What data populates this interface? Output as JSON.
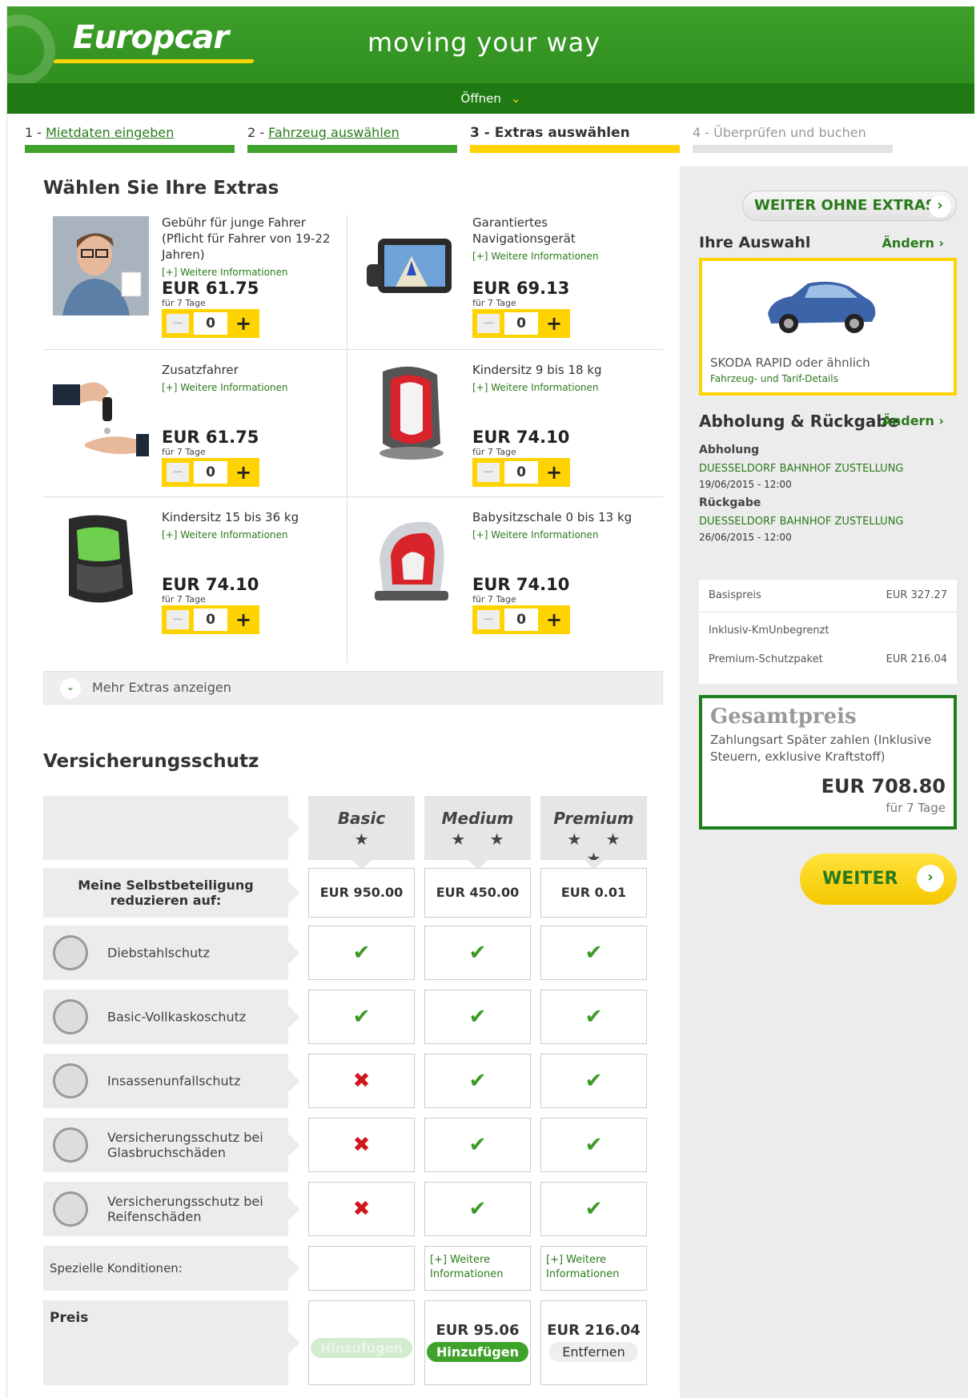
{
  "header": {
    "logo": "Europcar",
    "tagline": "moving your way",
    "open_label": "Öffnen"
  },
  "steps": [
    {
      "num": "1 - ",
      "label": "Mietdaten eingeben"
    },
    {
      "num": "2 - ",
      "label": "Fahrzeug auswählen"
    },
    {
      "num": "3 - ",
      "label": "Extras auswählen"
    },
    {
      "num": "4 - ",
      "label": "Überprüfen und buchen"
    }
  ],
  "extras": {
    "title": "Wählen Sie Ihre Extras",
    "more_info": "[+] Weitere Informationen",
    "items": [
      {
        "name": "Gebühr für junge Fahrer (Pflicht für Fahrer von 19-22 Jahren)",
        "price": "EUR 61.75",
        "days": "für 7 Tage",
        "qty": "0"
      },
      {
        "name": "Garantiertes Navigationsgerät",
        "price": "EUR 69.13",
        "days": "für 7 Tage",
        "qty": "0"
      },
      {
        "name": "Zusatzfahrer",
        "price": "EUR 61.75",
        "days": "für 7 Tage",
        "qty": "0"
      },
      {
        "name": "Kindersitz 9 bis 18 kg",
        "price": "EUR 74.10",
        "days": "für 7 Tage",
        "qty": "0"
      },
      {
        "name": "Kindersitz 15 bis 36 kg",
        "price": "EUR 74.10",
        "days": "für 7 Tage",
        "qty": "0"
      },
      {
        "name": "Babysitzschale 0 bis 13 kg",
        "price": "EUR 74.10",
        "days": "für 7 Tage",
        "qty": "0"
      }
    ],
    "show_more": "Mehr Extras anzeigen"
  },
  "insurance": {
    "title": "Versicherungsschutz",
    "plans": [
      {
        "name": "Basic",
        "stars": "★",
        "deductible": "EUR 950.00",
        "price": "",
        "action": "Hinzufügen"
      },
      {
        "name": "Medium",
        "stars": "★ ★",
        "deductible": "EUR 450.00",
        "price": "EUR 95.06",
        "action": "Hinzufügen"
      },
      {
        "name": "Premium",
        "stars": "★ ★ ★",
        "deductible": "EUR 0.01",
        "price": "EUR 216.04",
        "action": "Entfernen"
      }
    ],
    "deductible_label": "Meine Selbstbeteiligung reduzieren auf:",
    "features": [
      {
        "label": "Diebstahlschutz",
        "vals": [
          "✔",
          "✔",
          "✔"
        ]
      },
      {
        "label": "Basic-Vollkaskoschutz",
        "vals": [
          "✔",
          "✔",
          "✔"
        ]
      },
      {
        "label": "Insassenunfallschutz",
        "vals": [
          "✖",
          "✔",
          "✔"
        ]
      },
      {
        "label": "Versicherungsschutz bei Glasbruchschäden",
        "vals": [
          "✖",
          "✔",
          "✔"
        ]
      },
      {
        "label": "Versicherungsschutz bei Reifenschäden",
        "vals": [
          "✖",
          "✔",
          "✔"
        ]
      }
    ],
    "special_label": "Spezielle Konditionen:",
    "special_link": "[+] Weitere Informationen",
    "price_label": "Preis"
  },
  "sidebar": {
    "skip": "WEITER OHNE EXTRAS",
    "selection_title": "Ihre Auswahl",
    "change": "Ändern",
    "car_name": "SKODA RAPID oder ähnlich",
    "car_details": "Fahrzeug- und Tarif-Details",
    "pickup_title": "Abholung & Rückgabe",
    "pickup_label": "Abholung",
    "pickup_loc": "DUESSELDORF BAHNHOF ZUSTELLUNG",
    "pickup_date": "19/06/2015 - 12:00",
    "return_label": "Rückgabe",
    "return_loc": "DUESSELDORF BAHNHOF ZUSTELLUNG",
    "return_date": "26/06/2015 - 12:00",
    "base_label": "Basispreis",
    "base_val": "EUR 327.27",
    "km_label": "Inklusiv-KmUnbegrenzt",
    "premium_label": "Premium-Schutzpaket",
    "premium_val": "EUR 216.04",
    "total_title": "Gesamtpreis",
    "total_desc": "Zahlungsart Später zahlen (Inklusive Steuern, exklusive Kraftstoff)",
    "total_price": "EUR 708.80",
    "total_days": "für 7 Tage",
    "next": "WEITER"
  }
}
